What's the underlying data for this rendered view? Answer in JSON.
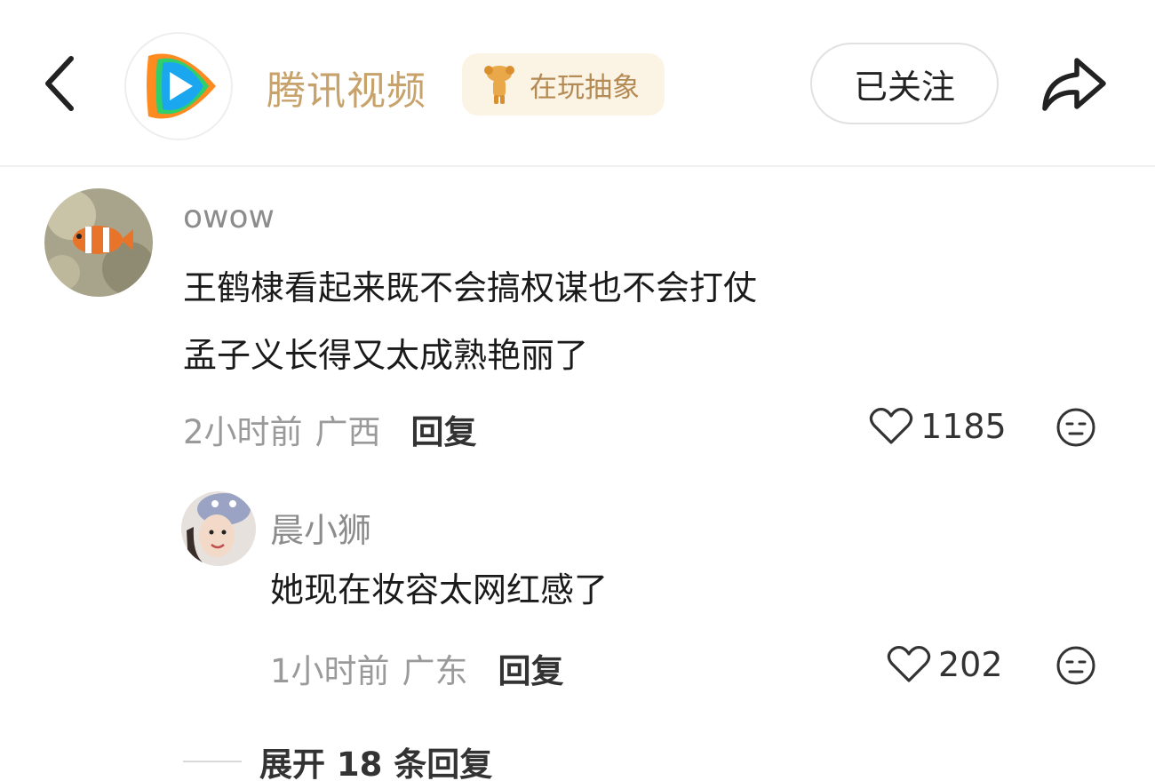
{
  "header": {
    "channel_name": "腾讯视频",
    "badge_text": "在玩抽象",
    "follow_label": "已关注",
    "colors": {
      "channel_name": "#c7a26b",
      "badge_bg": "#fbf3e4",
      "logo_orange": "#ff8a1f",
      "logo_green": "#2fcf6b",
      "logo_blue": "#1aa7f0"
    }
  },
  "comments": [
    {
      "username": "owow",
      "lines": [
        "王鹤棣看起来既不会搞权谋也不会打仗",
        "孟子义长得又太成熟艳丽了"
      ],
      "time": "2小时前",
      "location": "广西",
      "reply_label": "回复",
      "likes": "1185"
    },
    {
      "username": "晨小狮",
      "lines": [
        "她现在妆容太网红感了"
      ],
      "time": "1小时前",
      "location": "广东",
      "reply_label": "回复",
      "likes": "202"
    }
  ],
  "expand_label": "展开 18 条回复",
  "icons": [
    "back-arrow-icon",
    "tencent-video-logo-icon",
    "badge-mascot-icon",
    "share-icon",
    "heart-icon",
    "reaction-face-icon"
  ]
}
